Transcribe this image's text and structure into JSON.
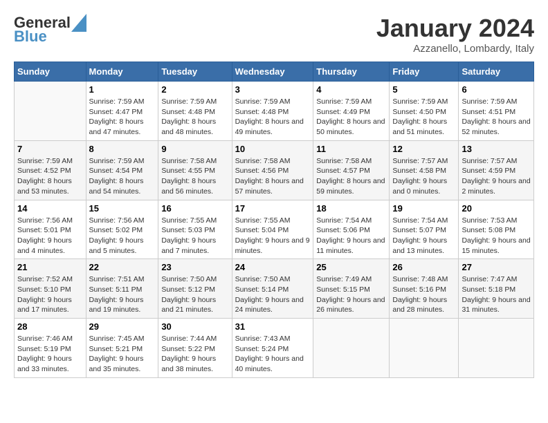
{
  "header": {
    "logo_line1": "General",
    "logo_line2": "Blue",
    "title": "January 2024",
    "subtitle": "Azzanello, Lombardy, Italy"
  },
  "days_of_week": [
    "Sunday",
    "Monday",
    "Tuesday",
    "Wednesday",
    "Thursday",
    "Friday",
    "Saturday"
  ],
  "weeks": [
    [
      {
        "day": "",
        "sunrise": "",
        "sunset": "",
        "daylight": ""
      },
      {
        "day": "1",
        "sunrise": "Sunrise: 7:59 AM",
        "sunset": "Sunset: 4:47 PM",
        "daylight": "Daylight: 8 hours and 47 minutes."
      },
      {
        "day": "2",
        "sunrise": "Sunrise: 7:59 AM",
        "sunset": "Sunset: 4:48 PM",
        "daylight": "Daylight: 8 hours and 48 minutes."
      },
      {
        "day": "3",
        "sunrise": "Sunrise: 7:59 AM",
        "sunset": "Sunset: 4:48 PM",
        "daylight": "Daylight: 8 hours and 49 minutes."
      },
      {
        "day": "4",
        "sunrise": "Sunrise: 7:59 AM",
        "sunset": "Sunset: 4:49 PM",
        "daylight": "Daylight: 8 hours and 50 minutes."
      },
      {
        "day": "5",
        "sunrise": "Sunrise: 7:59 AM",
        "sunset": "Sunset: 4:50 PM",
        "daylight": "Daylight: 8 hours and 51 minutes."
      },
      {
        "day": "6",
        "sunrise": "Sunrise: 7:59 AM",
        "sunset": "Sunset: 4:51 PM",
        "daylight": "Daylight: 8 hours and 52 minutes."
      }
    ],
    [
      {
        "day": "7",
        "sunrise": "Sunrise: 7:59 AM",
        "sunset": "Sunset: 4:52 PM",
        "daylight": "Daylight: 8 hours and 53 minutes."
      },
      {
        "day": "8",
        "sunrise": "Sunrise: 7:59 AM",
        "sunset": "Sunset: 4:54 PM",
        "daylight": "Daylight: 8 hours and 54 minutes."
      },
      {
        "day": "9",
        "sunrise": "Sunrise: 7:58 AM",
        "sunset": "Sunset: 4:55 PM",
        "daylight": "Daylight: 8 hours and 56 minutes."
      },
      {
        "day": "10",
        "sunrise": "Sunrise: 7:58 AM",
        "sunset": "Sunset: 4:56 PM",
        "daylight": "Daylight: 8 hours and 57 minutes."
      },
      {
        "day": "11",
        "sunrise": "Sunrise: 7:58 AM",
        "sunset": "Sunset: 4:57 PM",
        "daylight": "Daylight: 8 hours and 59 minutes."
      },
      {
        "day": "12",
        "sunrise": "Sunrise: 7:57 AM",
        "sunset": "Sunset: 4:58 PM",
        "daylight": "Daylight: 9 hours and 0 minutes."
      },
      {
        "day": "13",
        "sunrise": "Sunrise: 7:57 AM",
        "sunset": "Sunset: 4:59 PM",
        "daylight": "Daylight: 9 hours and 2 minutes."
      }
    ],
    [
      {
        "day": "14",
        "sunrise": "Sunrise: 7:56 AM",
        "sunset": "Sunset: 5:01 PM",
        "daylight": "Daylight: 9 hours and 4 minutes."
      },
      {
        "day": "15",
        "sunrise": "Sunrise: 7:56 AM",
        "sunset": "Sunset: 5:02 PM",
        "daylight": "Daylight: 9 hours and 5 minutes."
      },
      {
        "day": "16",
        "sunrise": "Sunrise: 7:55 AM",
        "sunset": "Sunset: 5:03 PM",
        "daylight": "Daylight: 9 hours and 7 minutes."
      },
      {
        "day": "17",
        "sunrise": "Sunrise: 7:55 AM",
        "sunset": "Sunset: 5:04 PM",
        "daylight": "Daylight: 9 hours and 9 minutes."
      },
      {
        "day": "18",
        "sunrise": "Sunrise: 7:54 AM",
        "sunset": "Sunset: 5:06 PM",
        "daylight": "Daylight: 9 hours and 11 minutes."
      },
      {
        "day": "19",
        "sunrise": "Sunrise: 7:54 AM",
        "sunset": "Sunset: 5:07 PM",
        "daylight": "Daylight: 9 hours and 13 minutes."
      },
      {
        "day": "20",
        "sunrise": "Sunrise: 7:53 AM",
        "sunset": "Sunset: 5:08 PM",
        "daylight": "Daylight: 9 hours and 15 minutes."
      }
    ],
    [
      {
        "day": "21",
        "sunrise": "Sunrise: 7:52 AM",
        "sunset": "Sunset: 5:10 PM",
        "daylight": "Daylight: 9 hours and 17 minutes."
      },
      {
        "day": "22",
        "sunrise": "Sunrise: 7:51 AM",
        "sunset": "Sunset: 5:11 PM",
        "daylight": "Daylight: 9 hours and 19 minutes."
      },
      {
        "day": "23",
        "sunrise": "Sunrise: 7:50 AM",
        "sunset": "Sunset: 5:12 PM",
        "daylight": "Daylight: 9 hours and 21 minutes."
      },
      {
        "day": "24",
        "sunrise": "Sunrise: 7:50 AM",
        "sunset": "Sunset: 5:14 PM",
        "daylight": "Daylight: 9 hours and 24 minutes."
      },
      {
        "day": "25",
        "sunrise": "Sunrise: 7:49 AM",
        "sunset": "Sunset: 5:15 PM",
        "daylight": "Daylight: 9 hours and 26 minutes."
      },
      {
        "day": "26",
        "sunrise": "Sunrise: 7:48 AM",
        "sunset": "Sunset: 5:16 PM",
        "daylight": "Daylight: 9 hours and 28 minutes."
      },
      {
        "day": "27",
        "sunrise": "Sunrise: 7:47 AM",
        "sunset": "Sunset: 5:18 PM",
        "daylight": "Daylight: 9 hours and 31 minutes."
      }
    ],
    [
      {
        "day": "28",
        "sunrise": "Sunrise: 7:46 AM",
        "sunset": "Sunset: 5:19 PM",
        "daylight": "Daylight: 9 hours and 33 minutes."
      },
      {
        "day": "29",
        "sunrise": "Sunrise: 7:45 AM",
        "sunset": "Sunset: 5:21 PM",
        "daylight": "Daylight: 9 hours and 35 minutes."
      },
      {
        "day": "30",
        "sunrise": "Sunrise: 7:44 AM",
        "sunset": "Sunset: 5:22 PM",
        "daylight": "Daylight: 9 hours and 38 minutes."
      },
      {
        "day": "31",
        "sunrise": "Sunrise: 7:43 AM",
        "sunset": "Sunset: 5:24 PM",
        "daylight": "Daylight: 9 hours and 40 minutes."
      },
      {
        "day": "",
        "sunrise": "",
        "sunset": "",
        "daylight": ""
      },
      {
        "day": "",
        "sunrise": "",
        "sunset": "",
        "daylight": ""
      },
      {
        "day": "",
        "sunrise": "",
        "sunset": "",
        "daylight": ""
      }
    ]
  ]
}
